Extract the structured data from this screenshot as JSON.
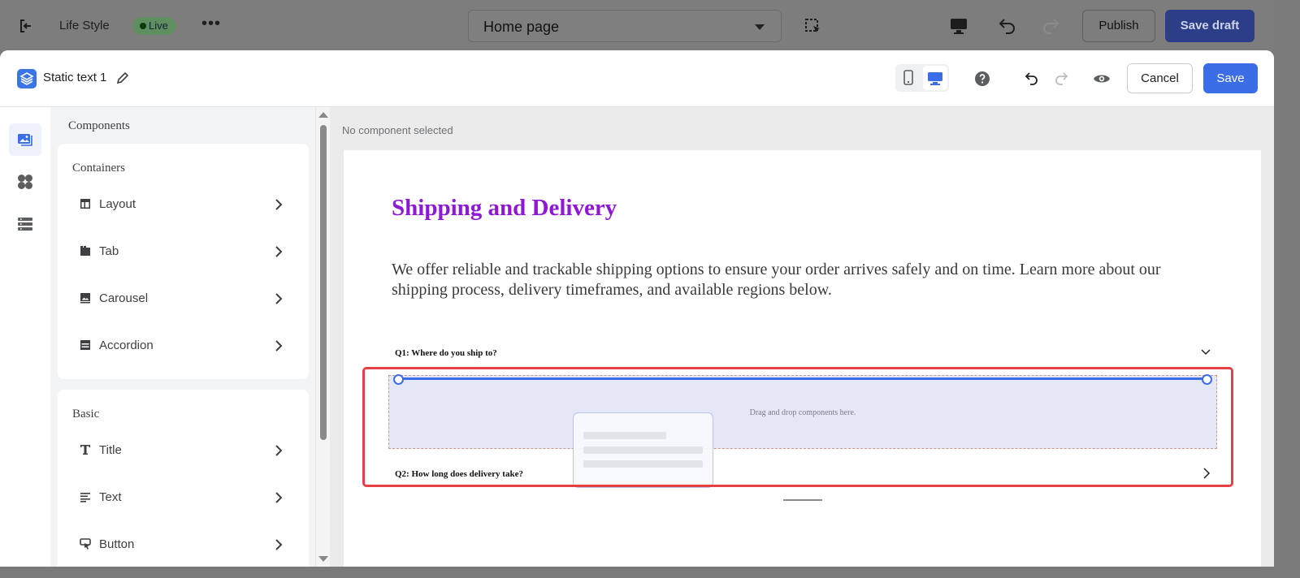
{
  "topbar": {
    "site_name": "Life Style",
    "status_badge": "Live",
    "more": "•••",
    "page_selector": "Home page",
    "publish": "Publish",
    "save_draft": "Save draft"
  },
  "editor": {
    "component_title": "Static text 1",
    "cancel": "Cancel",
    "save": "Save"
  },
  "panel": {
    "heading": "Components",
    "containers": {
      "title": "Containers",
      "items": [
        {
          "label": "Layout",
          "icon": "layout-icon"
        },
        {
          "label": "Tab",
          "icon": "tab-icon"
        },
        {
          "label": "Carousel",
          "icon": "image-icon"
        },
        {
          "label": "Accordion",
          "icon": "accordion-icon"
        }
      ]
    },
    "basic": {
      "title": "Basic",
      "items": [
        {
          "label": "Title",
          "icon": "title-icon"
        },
        {
          "label": "Text",
          "icon": "text-icon"
        },
        {
          "label": "Button",
          "icon": "button-icon"
        }
      ]
    }
  },
  "canvas": {
    "status": "No component selected",
    "heading": "Shipping and Delivery",
    "intro": "We offer reliable and trackable shipping options to ensure your order arrives safely and on time. Learn more about our shipping process, delivery timeframes, and available regions below.",
    "q1": "Q1: Where do you ship to?",
    "q2": "Q2: How long does delivery take?",
    "dropzone": "Drag and drop components here."
  },
  "colors": {
    "accent": "#3b6de7",
    "heading": "#8f18d6",
    "highlight": "#e64042",
    "live_badge": "#5f8f61"
  }
}
